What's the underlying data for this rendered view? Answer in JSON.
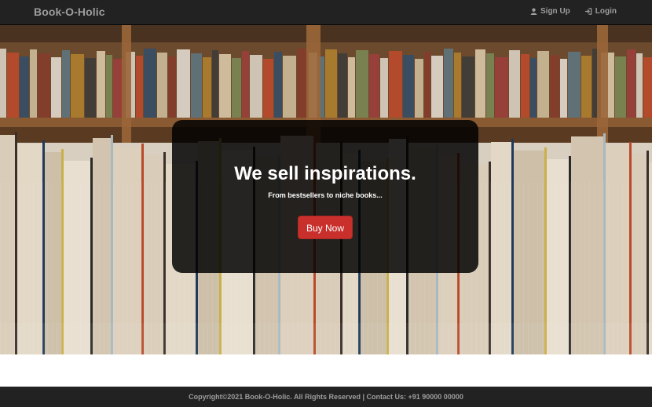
{
  "navbar": {
    "brand": "Book-O-Holic",
    "links": [
      {
        "label": "Sign Up",
        "icon": "user-icon"
      },
      {
        "label": "Login",
        "icon": "login-icon"
      }
    ]
  },
  "hero": {
    "title": "We sell inspirations.",
    "subtitle": "From bestsellers to niche books...",
    "button_label": "Buy Now"
  },
  "footer": {
    "text": "Copyright©2021 Book-O-Holic. All Rights Reserved | Contact Us: +91 90000 00000"
  },
  "colors": {
    "navbar_bg": "#222222",
    "nav_text": "#9d9d9d",
    "button": "#c9302c",
    "banner_overlay": "rgba(0,0,0,0.84)"
  }
}
